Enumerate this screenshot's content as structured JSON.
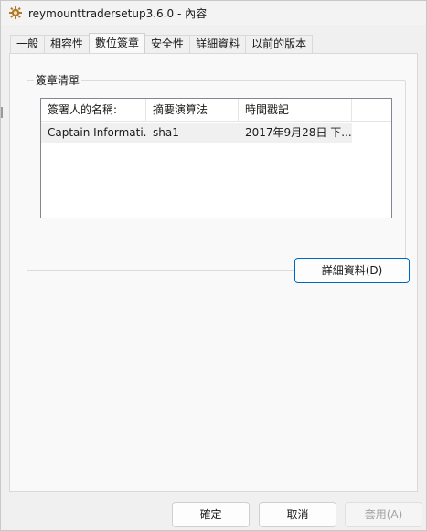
{
  "window": {
    "title": "reymounttradersetup3.6.0 - 內容"
  },
  "tabs": [
    {
      "label": "一般",
      "active": false
    },
    {
      "label": "相容性",
      "active": false
    },
    {
      "label": "數位簽章",
      "active": true
    },
    {
      "label": "安全性",
      "active": false
    },
    {
      "label": "詳細資料",
      "active": false
    },
    {
      "label": "以前的版本",
      "active": false
    }
  ],
  "signature_list": {
    "group_title": "簽章清單",
    "columns": [
      "簽署人的名稱:",
      "摘要演算法",
      "時間戳記"
    ],
    "rows": [
      [
        "Captain Informati...",
        "sha1",
        "2017年9月28日 下..."
      ]
    ],
    "details_button": "詳細資料(D)"
  },
  "footer": {
    "ok": "確定",
    "cancel": "取消",
    "apply": "套用(A)"
  },
  "colors": {
    "accent": "#0067c0",
    "selected_row": "#f0f0f0"
  }
}
